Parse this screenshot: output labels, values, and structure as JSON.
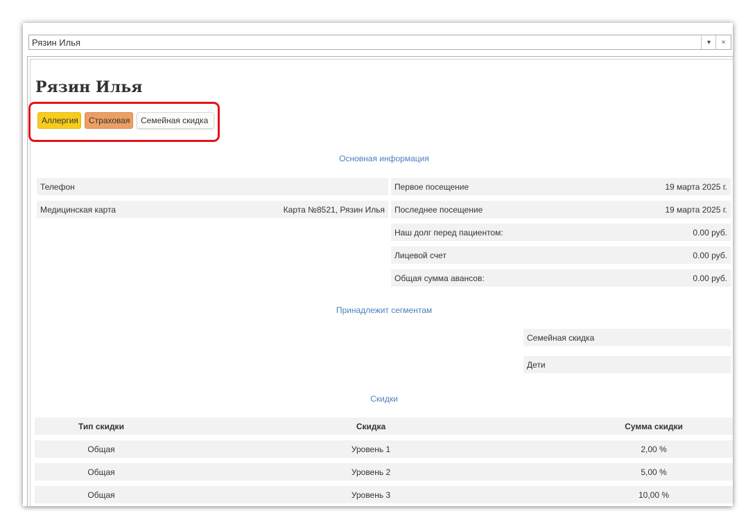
{
  "combo": {
    "value": "Рязин Илья"
  },
  "patient": {
    "name": "Рязин Илья"
  },
  "tags": [
    {
      "label": "Аллергия",
      "color": "#f7cc1d"
    },
    {
      "label": "Страховая",
      "color": "#ec9f63"
    },
    {
      "label": "Семейная скидка",
      "color": "#fbfbf9"
    }
  ],
  "sections": {
    "main_info": "Основная информация",
    "segments": "Принадлежит сегментам",
    "discounts": "Скидки"
  },
  "left_fields": [
    {
      "label": "Телефон",
      "value": ""
    },
    {
      "label": "Медицинская карта",
      "value": "Карта №8521, Рязин Илья"
    }
  ],
  "right_fields": [
    {
      "label": "Первое посещение",
      "value": "19 марта 2025 г."
    },
    {
      "label": "Последнее посещение",
      "value": "19 марта 2025 г."
    },
    {
      "label": "Наш долг перед пациентом:",
      "value": "0.00 руб."
    },
    {
      "label": "Лицевой счет",
      "value": "0.00 руб."
    },
    {
      "label": "Общая сумма авансов:",
      "value": "0.00 руб."
    }
  ],
  "segments": [
    "Семейная скидка",
    "Дети"
  ],
  "discount_table": {
    "headers": [
      "Тип скидки",
      "Скидка",
      "Сумма скидки"
    ],
    "rows": [
      [
        "Общая",
        "Уровень 1",
        "2,00 %"
      ],
      [
        "Общая",
        "Уровень 2",
        "5,00 %"
      ],
      [
        "Общая",
        "Уровень 3",
        "10,00 %"
      ]
    ]
  },
  "colors": {
    "highlight": "#e3121a",
    "section_link": "#4a7fc1",
    "row_bg": "#f2f2f2"
  }
}
